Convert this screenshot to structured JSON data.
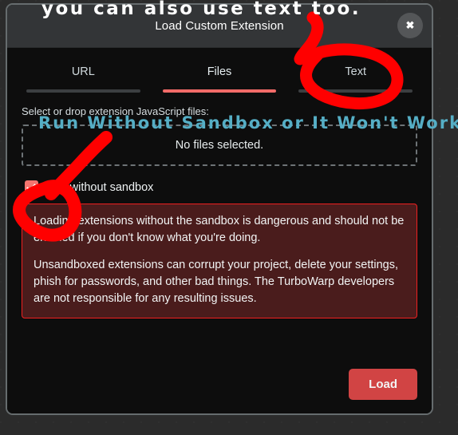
{
  "annotations": {
    "top_text": "you can also use text too.",
    "mid_text": "Run Without Sandbox or It Won't Work.",
    "ink_color": "#ff0000",
    "mid_text_color": "#55aec5",
    "top_text_color": "#ffffff"
  },
  "modal": {
    "title": "Load Custom Extension",
    "close_label": "✖"
  },
  "tabs": [
    {
      "label": "URL",
      "active": false
    },
    {
      "label": "Files",
      "active": true
    },
    {
      "label": "Text",
      "active": false
    }
  ],
  "content": {
    "files_label": "Select or drop extension JavaScript files:",
    "dropzone_text": "No files selected.",
    "sandbox_checkbox_label": "Run without sandbox",
    "sandbox_checked": true,
    "warning_paragraphs": [
      "Loading extensions without the sandbox is dangerous and should not be enabled if you don't know what you're doing.",
      "Unsandboxed extensions can corrupt your project, delete your settings, phish for passwords, and other bad things. The TurboWarp developers are not responsible for any resulting issues."
    ],
    "warning_border_color": "#f02020",
    "warning_background_color": "#4a1c1c"
  },
  "footer": {
    "load_label": "Load",
    "load_color": "#d14444"
  }
}
